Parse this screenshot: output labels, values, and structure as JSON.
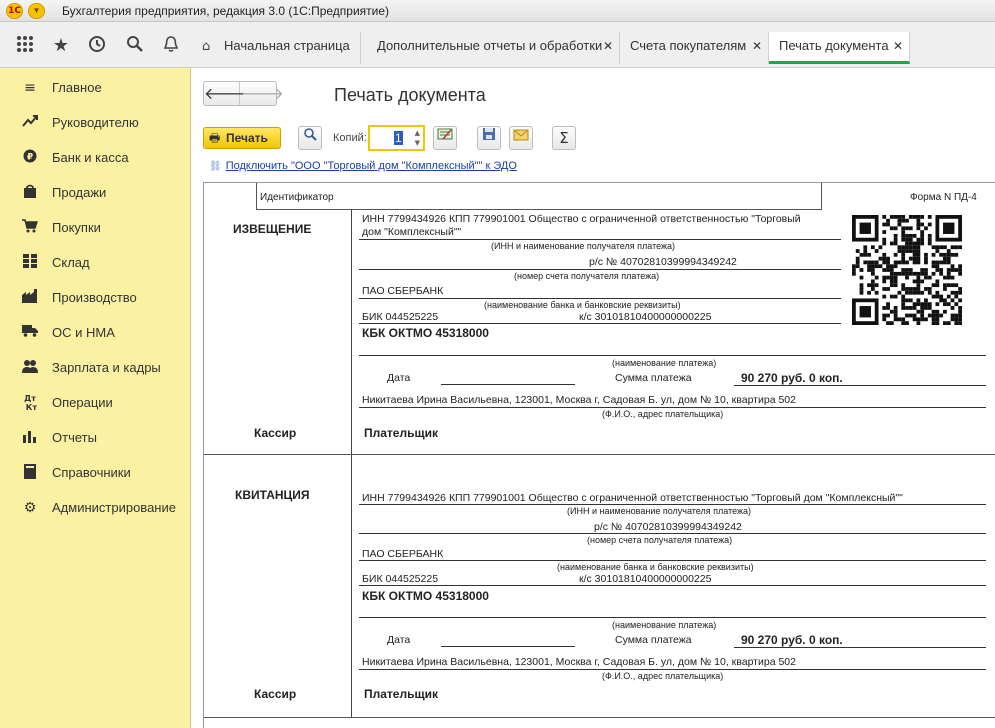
{
  "window": {
    "title": "Бухгалтерия предприятия, редакция 3.0  (1С:Предприятие)",
    "logo": "1С"
  },
  "tabs": [
    {
      "label": "Начальная страница",
      "closable": false,
      "active": false
    },
    {
      "label": "Дополнительные отчеты и обработки",
      "closable": true,
      "active": false
    },
    {
      "label": "Счета покупателям",
      "closable": true,
      "active": false
    },
    {
      "label": "Печать документа",
      "closable": true,
      "active": true
    }
  ],
  "sidebar": {
    "items": [
      {
        "label": "Главное",
        "icon": "menu-lines-icon"
      },
      {
        "label": "Руководителю",
        "icon": "trend-icon"
      },
      {
        "label": "Банк и касса",
        "icon": "coin-icon"
      },
      {
        "label": "Продажи",
        "icon": "bag-icon"
      },
      {
        "label": "Покупки",
        "icon": "cart-icon"
      },
      {
        "label": "Склад",
        "icon": "grid-icon"
      },
      {
        "label": "Производство",
        "icon": "factory-icon"
      },
      {
        "label": "ОС и НМА",
        "icon": "truck-icon"
      },
      {
        "label": "Зарплата и кадры",
        "icon": "people-icon"
      },
      {
        "label": "Операции",
        "icon": "dtkt-icon"
      },
      {
        "label": "Отчеты",
        "icon": "bar-chart-icon"
      },
      {
        "label": "Справочники",
        "icon": "book-icon"
      },
      {
        "label": "Администрирование",
        "icon": "gear-icon"
      }
    ]
  },
  "main": {
    "title": "Печать документа",
    "print_label": "Печать",
    "copies_label": "Копий:",
    "copies_value": "1",
    "edo_link": "Подключить \"ООО \"Торговый дом \"Комплексный\"\" к ЭДО"
  },
  "document": {
    "identifier_label": "Идентификатор",
    "form": "Форма N ПД-4",
    "notice": {
      "heading": "ИЗВЕЩЕНИЕ",
      "payee_line1": "ИНН 7799434926 КПП 779901001 Общество с ограниченной ответственностью \"Торговый",
      "payee_line2": "дом \"Комплексный\"\"",
      "payee_caption": "(ИНН и наименование получателя платежа)",
      "account": "р/с №  40702810399994349242",
      "account_caption": "(номер счета получателя платежа)",
      "bank": "ПАО СБЕРБАНК",
      "bank_caption": "(наименование банка и банковские реквизиты)",
      "bik": "БИК  044525225",
      "ks": "к/с  30101810400000000225",
      "kbk": "КБК  ОКТМО 45318000",
      "purpose_caption": "(наименование платежа)",
      "date_label": "Дата",
      "sum_label": "Сумма платежа",
      "sum": "90 270 руб. 0 коп.",
      "payer": "Никитаева Ирина Васильевна, 123001, Москва г, Садовая Б. ул, дом № 10, квартира 502",
      "payer_caption": "(Ф.И.О., адрес плательщика)",
      "cashier": "Кассир",
      "payer_sign": "Плательщик"
    },
    "receipt": {
      "heading": "КВИТАНЦИЯ",
      "payee_line1": "ИНН 7799434926 КПП 779901001 Общество с ограниченной ответственностью \"Торговый дом \"Комплексный\"\"",
      "payee_caption": "(ИНН и наименование получателя платежа)",
      "account": "р/с №  40702810399994349242",
      "account_caption": "(номер счета получателя платежа)",
      "bank": "ПАО СБЕРБАНК",
      "bank_caption": "(наименование банка и банковские реквизиты)",
      "bik": "БИК  044525225",
      "ks": "к/с  30101810400000000225",
      "kbk": "КБК  ОКТМО 45318000",
      "purpose_caption": "(наименование платежа)",
      "date_label": "Дата",
      "sum_label": "Сумма платежа",
      "sum": "90 270 руб. 0 коп.",
      "payer": "Никитаева Ирина Васильевна, 123001, Москва г, Садовая Б. ул, дом № 10, квартира 502",
      "payer_caption": "(Ф.И.О., адрес плательщика)",
      "cashier": "Кассир",
      "payer_sign": "Плательщик"
    }
  }
}
